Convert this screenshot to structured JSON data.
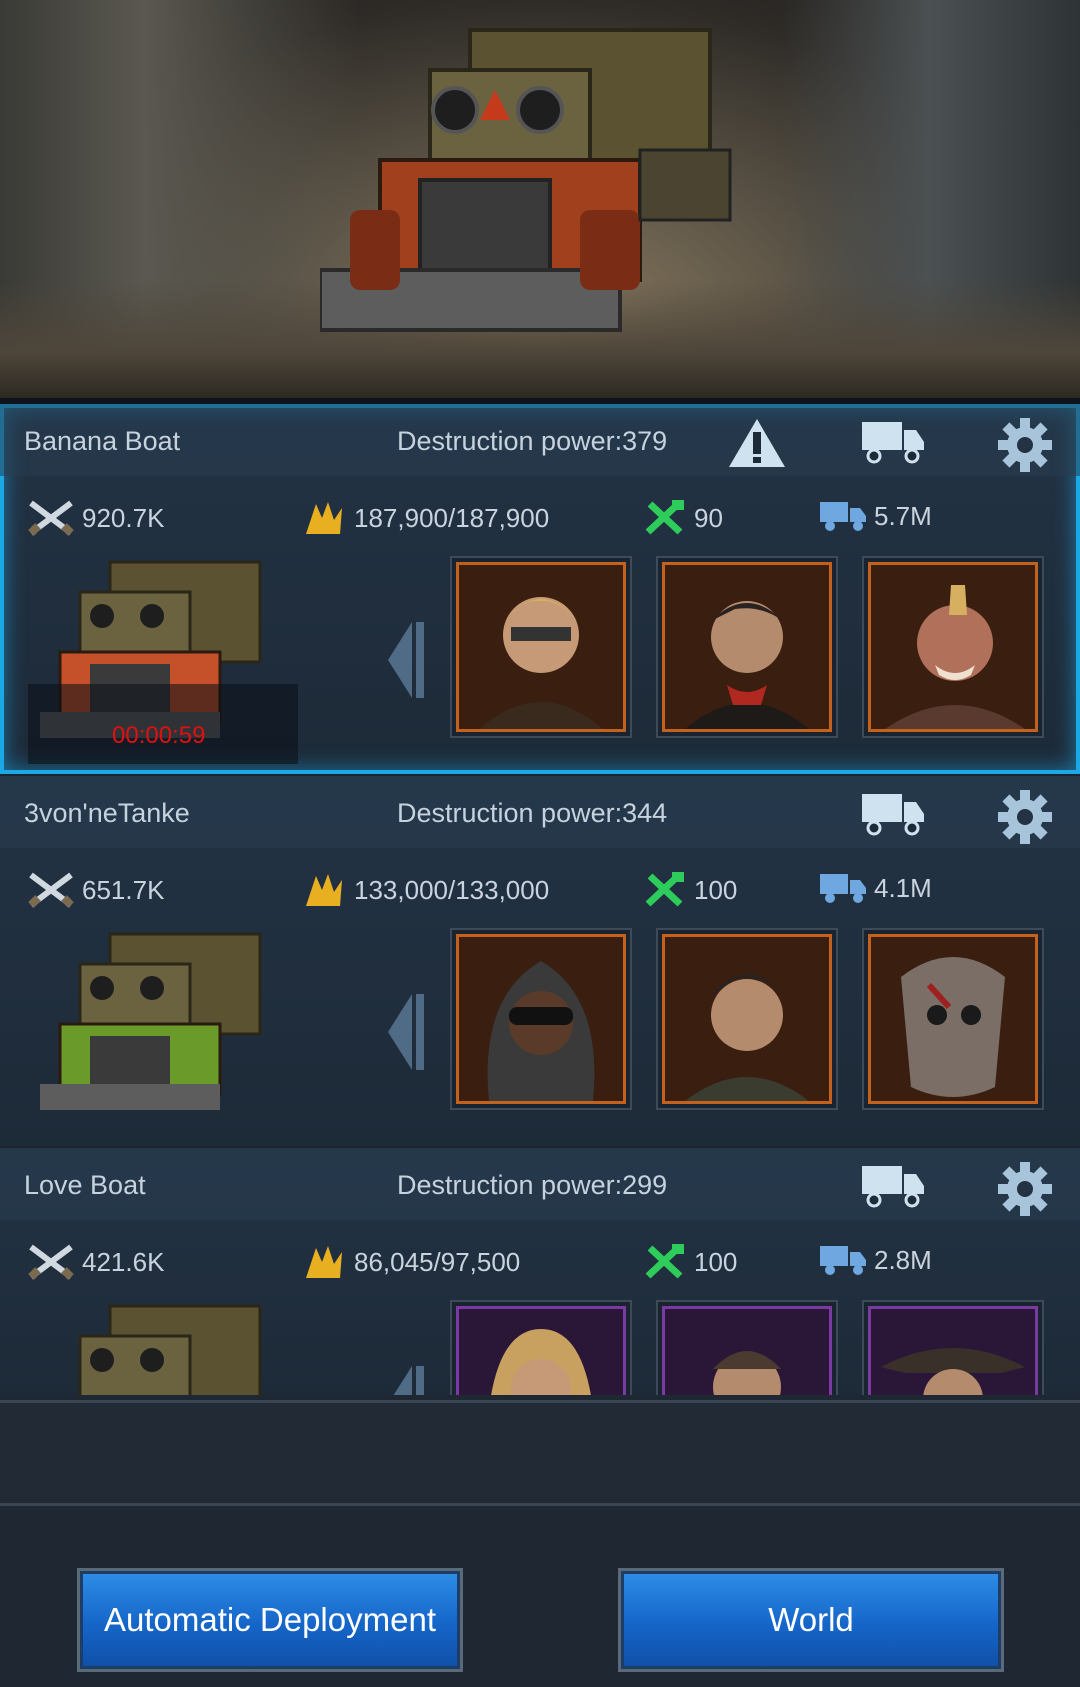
{
  "squads": [
    {
      "name": "Banana Boat",
      "power": "Destruction power:379",
      "attack": "920.7K",
      "troops": "187,900/187,900",
      "repair": "90",
      "load": "5.7M",
      "timer": "00:00:59",
      "warning": true,
      "truck_color": "#c4512a",
      "portrait_frame": "orange"
    },
    {
      "name": "3von'neTanke",
      "power": "Destruction power:344",
      "attack": "651.7K",
      "troops": "133,000/133,000",
      "repair": "100",
      "load": "4.1M",
      "truck_color": "#6a9a2a",
      "portrait_frame": "orange"
    },
    {
      "name": "Love Boat",
      "power": "Destruction power:299",
      "attack": "421.6K",
      "troops": "86,045/97,500",
      "repair": "100",
      "load": "2.8M",
      "truck_color": "#6a9a2a",
      "portrait_frame": "purple"
    }
  ],
  "buttons": {
    "auto_deploy": "Automatic Deployment",
    "world": "World"
  },
  "icons": [
    "crossed-guns-icon",
    "soldiers-icon",
    "wrench-hammer-icon",
    "cargo-truck-icon",
    "truck-icon",
    "gear-icon",
    "warning-icon",
    "left-arrow-icon"
  ]
}
